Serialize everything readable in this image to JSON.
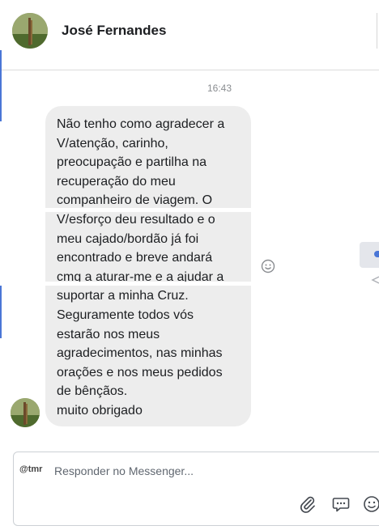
{
  "header": {
    "contact_name": "José Fernandes"
  },
  "conversation": {
    "timestamp": "16:43",
    "message": "Não tenho como agradecer a\nV/atenção, carinho,\npreocupação e partilha na\nrecuperação do meu\ncompanheiro de viagem. O\nV/esforço deu resultado e o\nmeu cajado/bordão já foi\nencontrado e breve andará\ncmg a aturar-me e a ajudar a\nsuportar a minha Cruz.\nSeguramente todos vós\nestarão nos meus\nagradecimentos, nas minhas\norações e nos meus pedidos\nde bênçãos.\nmuito obrigado"
  },
  "composer": {
    "badge": "@tmr",
    "placeholder": "Responder no Messenger..."
  },
  "icons": {
    "reaction": "smiley-icon",
    "attach": "paperclip-icon",
    "sticker": "chat-bubble-icon",
    "emoji": "smiley-icon"
  },
  "colors": {
    "accent": "#4a76d6",
    "bubble": "#ededed",
    "text": "#1c1e21",
    "muted": "#8a8d91"
  }
}
